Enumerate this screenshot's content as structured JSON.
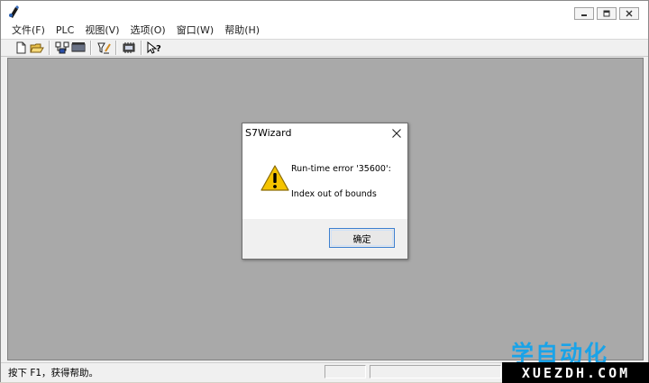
{
  "menubar": {
    "items": [
      "文件(F)",
      "PLC",
      "视图(V)",
      "选项(O)",
      "窗口(W)",
      "帮助(H)"
    ]
  },
  "toolbar": {
    "icons": [
      "new-file-icon",
      "open-folder-icon",
      "network-icon",
      "plc-module-icon",
      "tag-pen-icon",
      "memory-chip-icon",
      "help-pointer-icon"
    ]
  },
  "dialog": {
    "title": "S7Wizard",
    "message_line1": "Run-time error '35600':",
    "message_line2": "Index out of bounds",
    "ok_label": "确定"
  },
  "statusbar": {
    "text": "按下 F1，获得帮助。"
  },
  "watermark": {
    "cn": "学自动化",
    "en": "XUEZDH.COM"
  },
  "colors": {
    "workspace": "#a9a9a9",
    "watermark_blue": "#1aa3e8",
    "warning_yellow": "#f5c400"
  }
}
